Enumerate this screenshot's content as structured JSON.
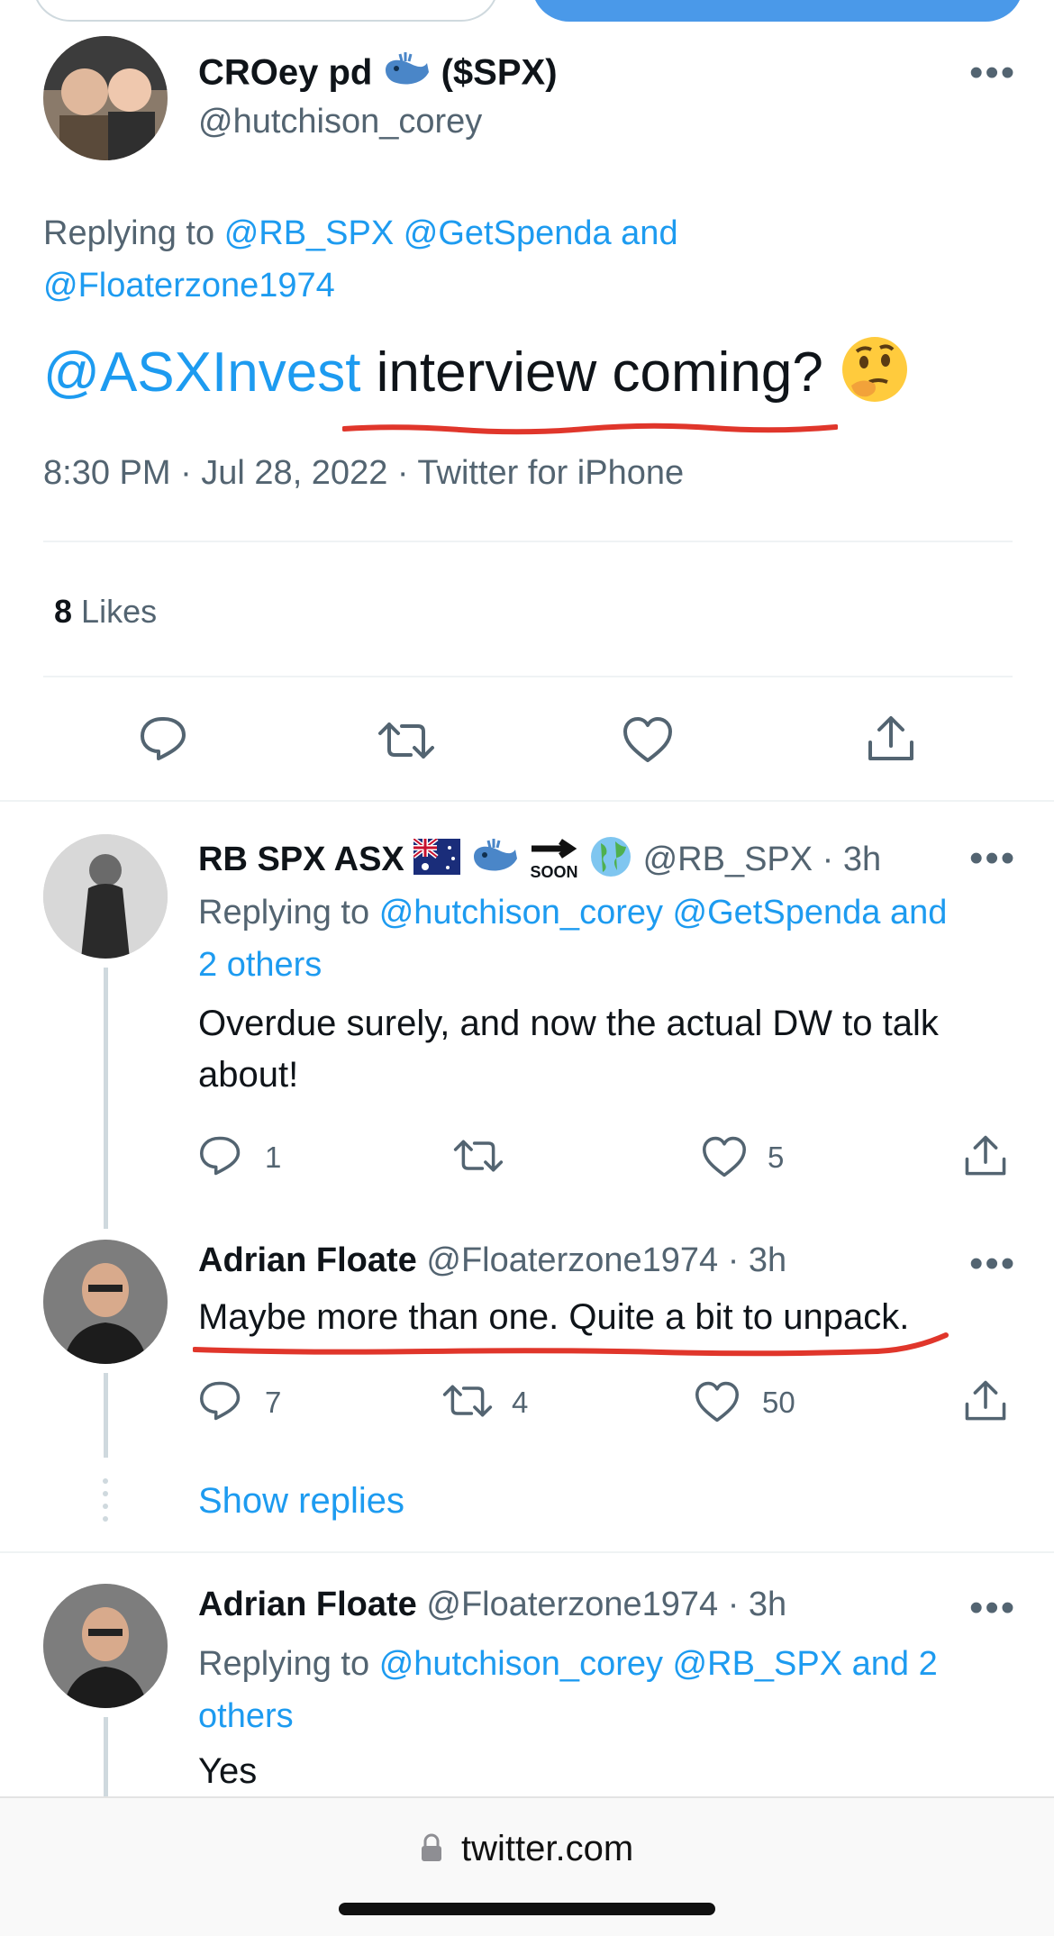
{
  "top_buttons": {
    "left_label": "",
    "right_label": ""
  },
  "main_tweet": {
    "display_name": "CROey pd",
    "name_suffix": "($SPX)",
    "handle": "@hutchison_corey",
    "replying_prefix": "Replying to",
    "replying_links": "@RB_SPX @GetSpenda and",
    "replying_links_2": "@Floaterzone1974",
    "mention": "@ASXInvest",
    "body_text": "interview coming?",
    "timestamp": "8:30 PM · Jul 28, 2022 · Twitter for iPhone",
    "likes_count": "8",
    "likes_label": "Likes"
  },
  "replies": [
    {
      "display_name": "RB SPX ASX",
      "soon_badge": "SOON",
      "handle_time": "@RB_SPX · 3h",
      "replying_prefix": "Replying to",
      "replying_links": "@hutchison_corey @GetSpenda and",
      "replying_links_2": "2 others",
      "body_line1": "Overdue surely, and now the actual DW to talk",
      "body_line2": "about!",
      "reply_count": "1",
      "retweet_count": "",
      "like_count": "5"
    },
    {
      "display_name": "Adrian Floate",
      "handle_time": "@Floaterzone1974 · 3h",
      "body_line1": "Maybe more than one. Quite a bit to unpack.",
      "reply_count": "7",
      "retweet_count": "4",
      "like_count": "50",
      "show_replies": "Show replies"
    },
    {
      "display_name": "Adrian Floate",
      "handle_time": "@Floaterzone1974 · 3h",
      "replying_prefix": "Replying to",
      "replying_links": "@hutchison_corey @RB_SPX and 2",
      "replying_links_2": "others",
      "body_line1": "Yes"
    }
  ],
  "browser_bar": {
    "url": "twitter.com"
  },
  "colors": {
    "link": "#1d9bf0",
    "secondary_text": "#536471",
    "underline": "#e0362b",
    "divider": "#eff3f4"
  }
}
